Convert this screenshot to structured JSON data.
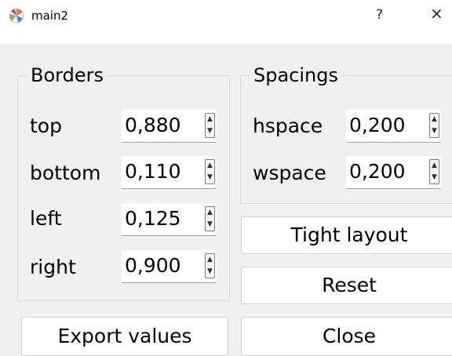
{
  "window": {
    "title": "main2",
    "help_label": "?",
    "close_label": "×"
  },
  "borders": {
    "legend": "Borders",
    "rows": [
      {
        "label": "top",
        "value": "0,880"
      },
      {
        "label": "bottom",
        "value": "0,110"
      },
      {
        "label": "left",
        "value": "0,125"
      },
      {
        "label": "right",
        "value": "0,900"
      }
    ]
  },
  "spacings": {
    "legend": "Spacings",
    "rows": [
      {
        "label": "hspace",
        "value": "0,200"
      },
      {
        "label": "wspace",
        "value": "0,200"
      }
    ]
  },
  "buttons": {
    "tight_layout": "Tight layout",
    "reset": "Reset",
    "export_values": "Export values",
    "close": "Close"
  },
  "spin": {
    "up_glyph": "▲",
    "down_glyph": "▼"
  }
}
